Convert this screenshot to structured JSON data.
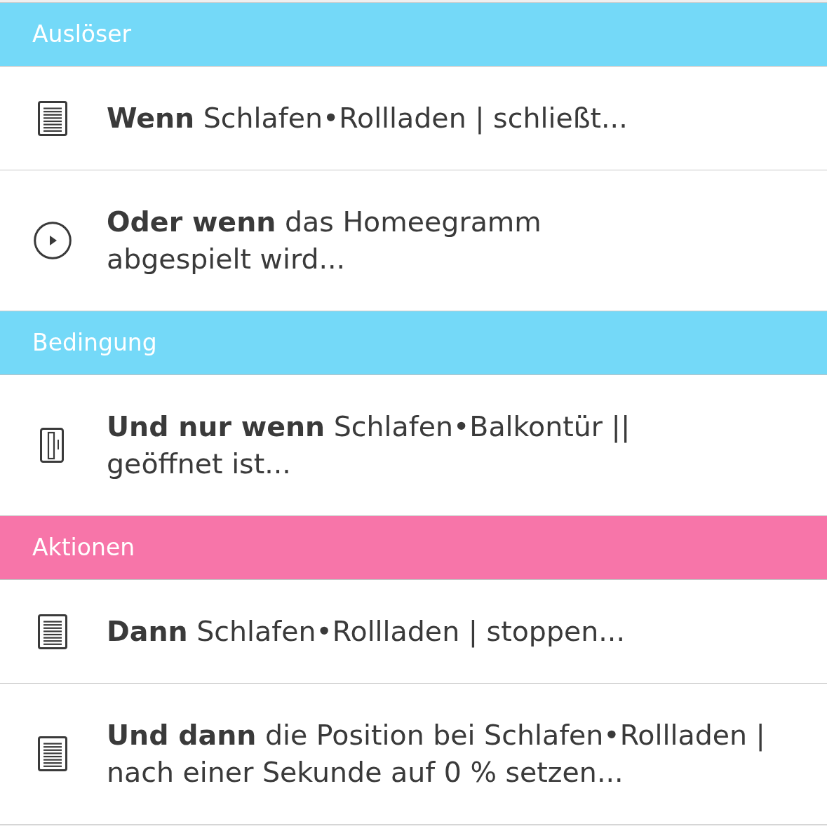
{
  "sections": [
    {
      "title": "Auslöser",
      "color": "#74d9f8",
      "items": [
        {
          "kind": "document",
          "lines": [
            "**Wenn** Schlafen•Rollladen | schließt..."
          ]
        },
        {
          "kind": "play",
          "lines": [
            "**Oder wenn** das Homeegramm",
            "abgespielt wird..."
          ]
        }
      ]
    },
    {
      "title": "Bedingung",
      "color": "#74d9f8",
      "items": [
        {
          "kind": "door",
          "lines": [
            "**Und nur wenn** Schlafen•Balkontür ||",
            "geöffnet ist..."
          ]
        }
      ]
    },
    {
      "title": "Aktionen",
      "color": "#f775a9",
      "items": [
        {
          "kind": "document",
          "lines": [
            "**Dann** Schlafen•Rollladen | stoppen..."
          ]
        },
        {
          "kind": "document",
          "lines": [
            "**Und dann** die Position bei Schlafen•Rollladen |",
            "nach einer Sekunde auf 0 % setzen..."
          ]
        }
      ]
    }
  ]
}
